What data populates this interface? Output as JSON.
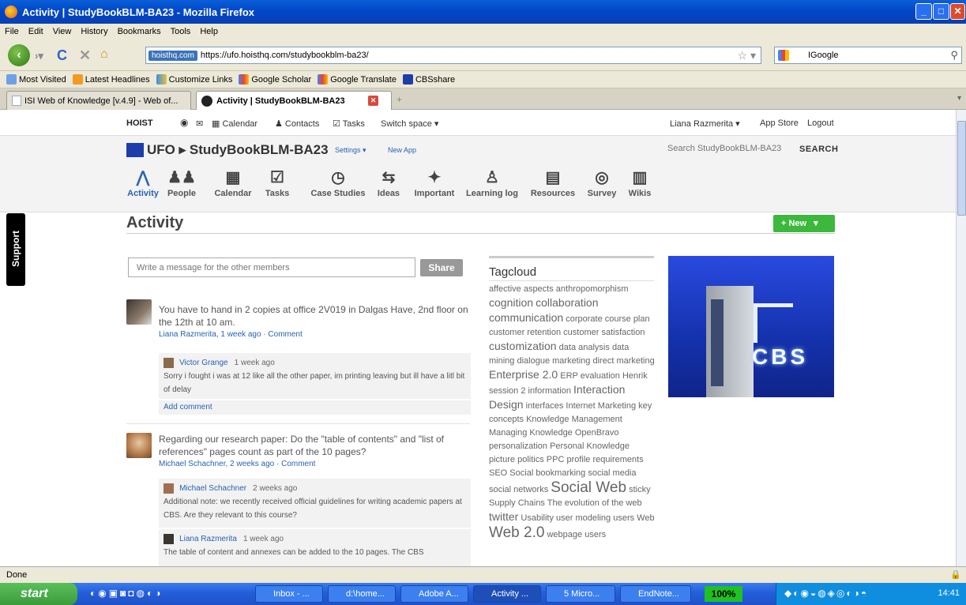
{
  "window": {
    "title": "Activity | StudyBookBLM-BA23 - Mozilla Firefox"
  },
  "menubar": [
    "File",
    "Edit",
    "View",
    "History",
    "Bookmarks",
    "Tools",
    "Help"
  ],
  "navbar": {
    "site_badge": "hoisthq.com",
    "url": "https://ufo.hoisthq.com/studybookblm-ba23/",
    "search_engine": "IGoogle"
  },
  "bookmarks": [
    "Most Visited",
    "Latest Headlines",
    "Customize Links",
    "Google Scholar",
    "Google Translate",
    "CBSshare"
  ],
  "tabs": [
    {
      "label": "ISI Web of Knowledge [v.4.9] - Web of..."
    },
    {
      "label": "Activity | StudyBookBLM-BA23"
    }
  ],
  "hoistbar": {
    "brand": "HOIST",
    "calendar": "Calendar",
    "contacts": "Contacts",
    "tasks": "Tasks",
    "switch_space": "Switch space",
    "user": "Liana Razmerita",
    "app_store": "App Store",
    "logout": "Logout"
  },
  "app": {
    "space_name": "UFO",
    "course": "StudyBookBLM-BA23",
    "settings": "Settings",
    "new_app": "New App",
    "search_placeholder": "Search StudyBookBLM-BA23",
    "search_button": "SEARCH"
  },
  "nav": [
    {
      "label": "Activity",
      "icon": "activity-icon"
    },
    {
      "label": "People",
      "icon": "people-icon"
    },
    {
      "label": "Calendar",
      "icon": "calendar-icon"
    },
    {
      "label": "Tasks",
      "icon": "tasks-icon"
    },
    {
      "label": "Case Studies",
      "icon": "clock-icon"
    },
    {
      "label": "Ideas",
      "icon": "ideas-icon"
    },
    {
      "label": "Important",
      "icon": "pin-icon"
    },
    {
      "label": "Learning log",
      "icon": "person-icon"
    },
    {
      "label": "Resources",
      "icon": "document-icon"
    },
    {
      "label": "Survey",
      "icon": "broadcast-icon"
    },
    {
      "label": "Wikis",
      "icon": "book-icon"
    }
  ],
  "page": {
    "title": "Activity",
    "new_button": "+ New",
    "message_placeholder": "Write a message for the other members",
    "share_button": "Share",
    "support": "Support"
  },
  "feed": [
    {
      "text": "You have to hand in 2 copies at office 2V019 in Dalgas Have, 2nd floor on the 12th at 10 am.",
      "author": "Liana Razmerita",
      "time": ", 1 week ago",
      "comment": "Comment",
      "replies": [
        {
          "author": "Victor Grange",
          "time": "1 week ago",
          "text": "Sorry i fought i was at 12 like all the other paper, im printing leaving but ill have a litl bit of delay"
        }
      ],
      "add_comment": "Add comment"
    },
    {
      "text": "Regarding our research paper: Do the \"table of contents\" and \"list of references\" pages count as part of the 10 pages?",
      "author": "Michael Schachner",
      "time": ", 2 weeks ago",
      "comment": "Comment",
      "replies": [
        {
          "author": "Michael Schachner",
          "time": "2 weeks ago",
          "text": "Additional note: we recently received official guidelines for writing academic papers at CBS. Are they relevant to this course?"
        },
        {
          "author": "Liana Razmerita",
          "time": "1 week ago",
          "text": "The table of content and annexes can be added to the 10 pages. The CBS"
        }
      ]
    }
  ],
  "tagcloud": {
    "title": "Tagcloud",
    "tags": [
      {
        "t": "affective aspects",
        "s": 11
      },
      {
        "t": "anthropomorphism",
        "s": 11
      },
      {
        "t": "cognition",
        "s": 14
      },
      {
        "t": "collaboration",
        "s": 14
      },
      {
        "t": "communication",
        "s": 14
      },
      {
        "t": "corporate course plan",
        "s": 11
      },
      {
        "t": "customer retention",
        "s": 11
      },
      {
        "t": "customer satisfaction",
        "s": 11
      },
      {
        "t": "customization",
        "s": 14
      },
      {
        "t": "data analysis",
        "s": 11
      },
      {
        "t": "data mining",
        "s": 11
      },
      {
        "t": "dialogue marketing",
        "s": 11
      },
      {
        "t": "direct marketing",
        "s": 11
      },
      {
        "t": "Enterprise 2.0",
        "s": 14
      },
      {
        "t": "ERP",
        "s": 11
      },
      {
        "t": "evaluation",
        "s": 11
      },
      {
        "t": "Henrik",
        "s": 11
      },
      {
        "t": "session 2",
        "s": 11
      },
      {
        "t": "information",
        "s": 11
      },
      {
        "t": "Interaction Design",
        "s": 14
      },
      {
        "t": "interfaces",
        "s": 11
      },
      {
        "t": "Internet Marketing",
        "s": 11
      },
      {
        "t": "key concepts",
        "s": 11
      },
      {
        "t": "Knowledge Management",
        "s": 11
      },
      {
        "t": "Managing Knowledge",
        "s": 11
      },
      {
        "t": "OpenBravo",
        "s": 11
      },
      {
        "t": "personalization",
        "s": 11
      },
      {
        "t": "Personal Knowledge",
        "s": 11
      },
      {
        "t": "picture",
        "s": 11
      },
      {
        "t": "politics",
        "s": 11
      },
      {
        "t": "PPC",
        "s": 11
      },
      {
        "t": "profile",
        "s": 11
      },
      {
        "t": "requirements",
        "s": 11
      },
      {
        "t": "SEO",
        "s": 11
      },
      {
        "t": "Social bookmarking",
        "s": 11
      },
      {
        "t": "social media",
        "s": 11
      },
      {
        "t": "social networks",
        "s": 11
      },
      {
        "t": "Social Web",
        "s": 19
      },
      {
        "t": "sticky",
        "s": 11
      },
      {
        "t": "Supply Chains",
        "s": 11
      },
      {
        "t": "The evolution of the web",
        "s": 11
      },
      {
        "t": "twitter",
        "s": 14
      },
      {
        "t": "Usability",
        "s": 11
      },
      {
        "t": "user modeling",
        "s": 11
      },
      {
        "t": "users",
        "s": 11
      },
      {
        "t": "Web",
        "s": 11
      },
      {
        "t": "Web 2.0",
        "s": 19
      },
      {
        "t": "webpage",
        "s": 11
      },
      {
        "t": "users",
        "s": 11
      }
    ]
  },
  "cbs_image": {
    "caption": "CBS"
  },
  "status": {
    "text": "Done"
  },
  "taskbar": {
    "start": "start",
    "items": [
      "Inbox - ...",
      "d:\\home...",
      "Adobe A...",
      "Activity ...",
      "5 Micro...",
      "EndNote..."
    ],
    "zoom": "100%",
    "clock": "14:41"
  },
  "colors": {
    "link": "#2a62b4",
    "green": "#3cb83c",
    "titlebar": "#0a5fd8"
  }
}
